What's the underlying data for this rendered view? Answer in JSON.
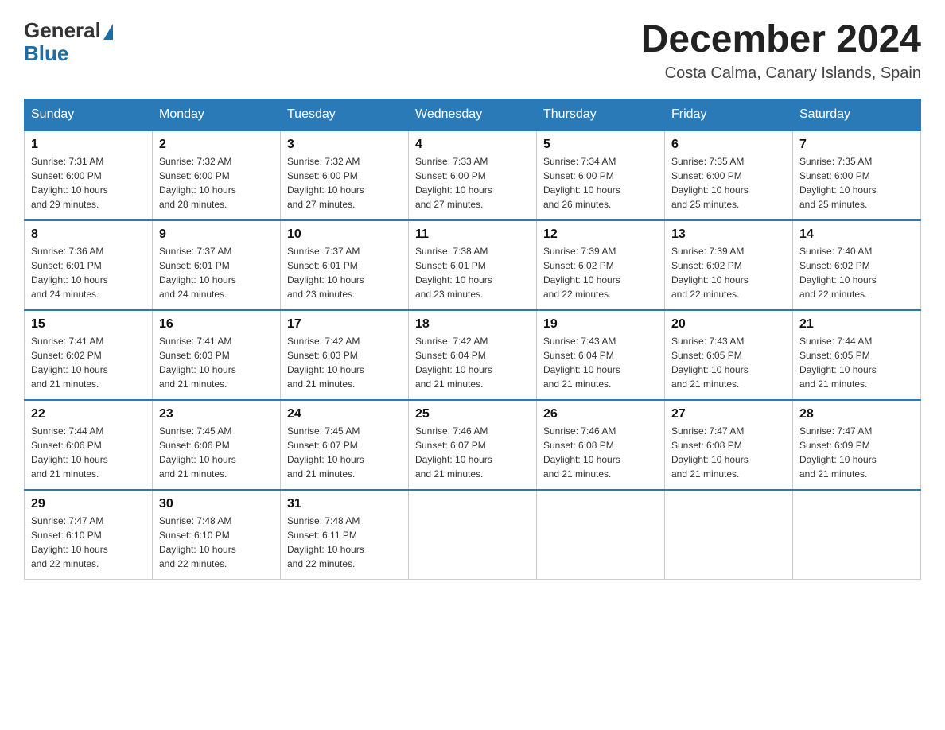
{
  "header": {
    "logo_text_general": "General",
    "logo_text_blue": "Blue",
    "month_title": "December 2024",
    "location": "Costa Calma, Canary Islands, Spain"
  },
  "days_of_week": [
    "Sunday",
    "Monday",
    "Tuesday",
    "Wednesday",
    "Thursday",
    "Friday",
    "Saturday"
  ],
  "weeks": [
    [
      {
        "day": "1",
        "sunrise": "7:31 AM",
        "sunset": "6:00 PM",
        "daylight": "10 hours and 29 minutes."
      },
      {
        "day": "2",
        "sunrise": "7:32 AM",
        "sunset": "6:00 PM",
        "daylight": "10 hours and 28 minutes."
      },
      {
        "day": "3",
        "sunrise": "7:32 AM",
        "sunset": "6:00 PM",
        "daylight": "10 hours and 27 minutes."
      },
      {
        "day": "4",
        "sunrise": "7:33 AM",
        "sunset": "6:00 PM",
        "daylight": "10 hours and 27 minutes."
      },
      {
        "day": "5",
        "sunrise": "7:34 AM",
        "sunset": "6:00 PM",
        "daylight": "10 hours and 26 minutes."
      },
      {
        "day": "6",
        "sunrise": "7:35 AM",
        "sunset": "6:00 PM",
        "daylight": "10 hours and 25 minutes."
      },
      {
        "day": "7",
        "sunrise": "7:35 AM",
        "sunset": "6:00 PM",
        "daylight": "10 hours and 25 minutes."
      }
    ],
    [
      {
        "day": "8",
        "sunrise": "7:36 AM",
        "sunset": "6:01 PM",
        "daylight": "10 hours and 24 minutes."
      },
      {
        "day": "9",
        "sunrise": "7:37 AM",
        "sunset": "6:01 PM",
        "daylight": "10 hours and 24 minutes."
      },
      {
        "day": "10",
        "sunrise": "7:37 AM",
        "sunset": "6:01 PM",
        "daylight": "10 hours and 23 minutes."
      },
      {
        "day": "11",
        "sunrise": "7:38 AM",
        "sunset": "6:01 PM",
        "daylight": "10 hours and 23 minutes."
      },
      {
        "day": "12",
        "sunrise": "7:39 AM",
        "sunset": "6:02 PM",
        "daylight": "10 hours and 22 minutes."
      },
      {
        "day": "13",
        "sunrise": "7:39 AM",
        "sunset": "6:02 PM",
        "daylight": "10 hours and 22 minutes."
      },
      {
        "day": "14",
        "sunrise": "7:40 AM",
        "sunset": "6:02 PM",
        "daylight": "10 hours and 22 minutes."
      }
    ],
    [
      {
        "day": "15",
        "sunrise": "7:41 AM",
        "sunset": "6:02 PM",
        "daylight": "10 hours and 21 minutes."
      },
      {
        "day": "16",
        "sunrise": "7:41 AM",
        "sunset": "6:03 PM",
        "daylight": "10 hours and 21 minutes."
      },
      {
        "day": "17",
        "sunrise": "7:42 AM",
        "sunset": "6:03 PM",
        "daylight": "10 hours and 21 minutes."
      },
      {
        "day": "18",
        "sunrise": "7:42 AM",
        "sunset": "6:04 PM",
        "daylight": "10 hours and 21 minutes."
      },
      {
        "day": "19",
        "sunrise": "7:43 AM",
        "sunset": "6:04 PM",
        "daylight": "10 hours and 21 minutes."
      },
      {
        "day": "20",
        "sunrise": "7:43 AM",
        "sunset": "6:05 PM",
        "daylight": "10 hours and 21 minutes."
      },
      {
        "day": "21",
        "sunrise": "7:44 AM",
        "sunset": "6:05 PM",
        "daylight": "10 hours and 21 minutes."
      }
    ],
    [
      {
        "day": "22",
        "sunrise": "7:44 AM",
        "sunset": "6:06 PM",
        "daylight": "10 hours and 21 minutes."
      },
      {
        "day": "23",
        "sunrise": "7:45 AM",
        "sunset": "6:06 PM",
        "daylight": "10 hours and 21 minutes."
      },
      {
        "day": "24",
        "sunrise": "7:45 AM",
        "sunset": "6:07 PM",
        "daylight": "10 hours and 21 minutes."
      },
      {
        "day": "25",
        "sunrise": "7:46 AM",
        "sunset": "6:07 PM",
        "daylight": "10 hours and 21 minutes."
      },
      {
        "day": "26",
        "sunrise": "7:46 AM",
        "sunset": "6:08 PM",
        "daylight": "10 hours and 21 minutes."
      },
      {
        "day": "27",
        "sunrise": "7:47 AM",
        "sunset": "6:08 PM",
        "daylight": "10 hours and 21 minutes."
      },
      {
        "day": "28",
        "sunrise": "7:47 AM",
        "sunset": "6:09 PM",
        "daylight": "10 hours and 21 minutes."
      }
    ],
    [
      {
        "day": "29",
        "sunrise": "7:47 AM",
        "sunset": "6:10 PM",
        "daylight": "10 hours and 22 minutes."
      },
      {
        "day": "30",
        "sunrise": "7:48 AM",
        "sunset": "6:10 PM",
        "daylight": "10 hours and 22 minutes."
      },
      {
        "day": "31",
        "sunrise": "7:48 AM",
        "sunset": "6:11 PM",
        "daylight": "10 hours and 22 minutes."
      },
      null,
      null,
      null,
      null
    ]
  ],
  "labels": {
    "sunrise": "Sunrise:",
    "sunset": "Sunset:",
    "daylight": "Daylight:"
  }
}
